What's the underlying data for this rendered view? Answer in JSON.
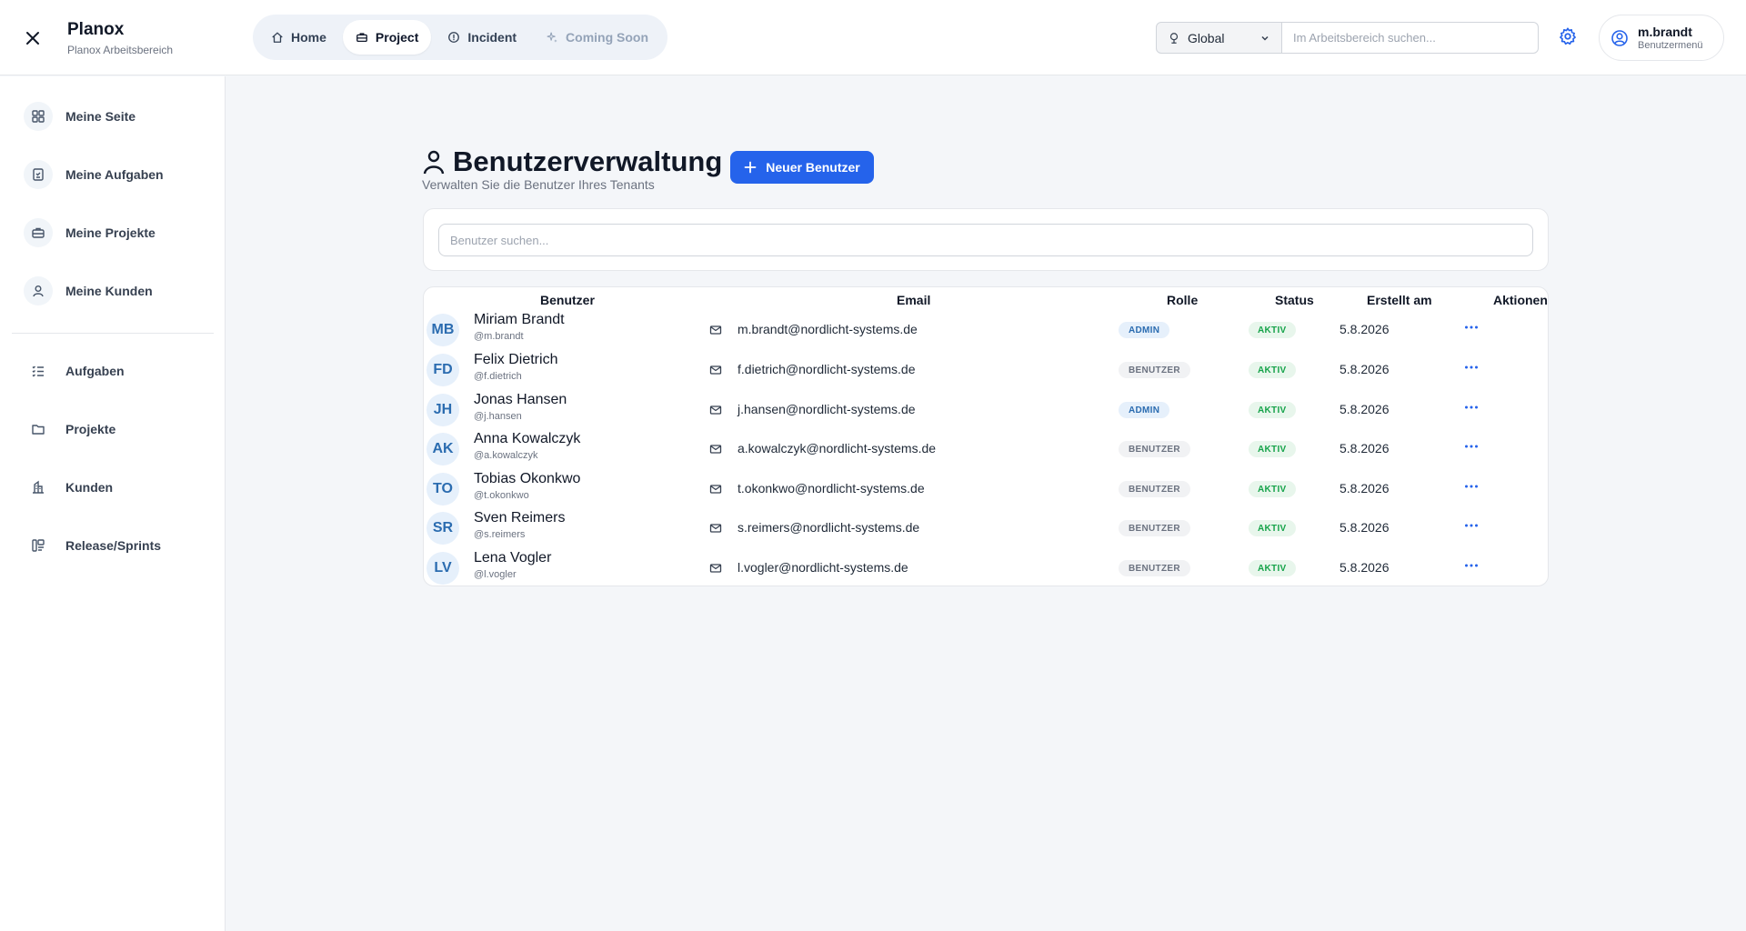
{
  "header": {
    "close_icon": "close-icon",
    "brand_title": "Planox",
    "brand_subtitle": "Planox Arbeitsbereich",
    "nav": [
      {
        "label": "Home",
        "icon": "home-icon"
      },
      {
        "label": "Project",
        "icon": "briefcase-icon",
        "active": true
      },
      {
        "label": "Incident",
        "icon": "alert-circle-icon"
      },
      {
        "label": "Coming Soon",
        "icon": "sparkles-icon",
        "disabled": true
      }
    ],
    "scope": "Global",
    "search_placeholder": "Im Arbeitsbereich suchen...",
    "user": {
      "name": "m.brandt",
      "menu_label": "Benutzermenü"
    }
  },
  "sidebar": {
    "personal": [
      {
        "label": "Meine Seite",
        "icon": "dashboard-icon"
      },
      {
        "label": "Meine Aufgaben",
        "icon": "task-icon"
      },
      {
        "label": "Meine Projekte",
        "icon": "briefcase-icon"
      },
      {
        "label": "Meine Kunden",
        "icon": "user-icon"
      }
    ],
    "general": [
      {
        "label": "Aufgaben",
        "icon": "list-check-icon"
      },
      {
        "label": "Projekte",
        "icon": "folder-icon"
      },
      {
        "label": "Kunden",
        "icon": "building-icon"
      },
      {
        "label": "Release/Sprints",
        "icon": "kanban-icon"
      }
    ]
  },
  "page": {
    "title": "Benutzerverwaltung",
    "subtitle": "Verwalten Sie die Benutzer Ihres Tenants",
    "new_button": "Neuer Benutzer",
    "search_placeholder": "Benutzer suchen..."
  },
  "table": {
    "columns": [
      "Benutzer",
      "Email",
      "Rolle",
      "Status",
      "Erstellt am",
      "Aktionen"
    ],
    "rows": [
      {
        "initials": "MB",
        "name": "Miriam Brandt",
        "handle": "@m.brandt",
        "email": "m.brandt@nordlicht-systems.de",
        "role": "ADMIN",
        "status": "AKTIV",
        "created": "5.8.2026"
      },
      {
        "initials": "FD",
        "name": "Felix Dietrich",
        "handle": "@f.dietrich",
        "email": "f.dietrich@nordlicht-systems.de",
        "role": "BENUTZER",
        "status": "AKTIV",
        "created": "5.8.2026"
      },
      {
        "initials": "JH",
        "name": "Jonas Hansen",
        "handle": "@j.hansen",
        "email": "j.hansen@nordlicht-systems.de",
        "role": "ADMIN",
        "status": "AKTIV",
        "created": "5.8.2026"
      },
      {
        "initials": "AK",
        "name": "Anna Kowalczyk",
        "handle": "@a.kowalczyk",
        "email": "a.kowalczyk@nordlicht-systems.de",
        "role": "BENUTZER",
        "status": "AKTIV",
        "created": "5.8.2026"
      },
      {
        "initials": "TO",
        "name": "Tobias Okonkwo",
        "handle": "@t.okonkwo",
        "email": "t.okonkwo@nordlicht-systems.de",
        "role": "BENUTZER",
        "status": "AKTIV",
        "created": "5.8.2026"
      },
      {
        "initials": "SR",
        "name": "Sven Reimers",
        "handle": "@s.reimers",
        "email": "s.reimers@nordlicht-systems.de",
        "role": "BENUTZER",
        "status": "AKTIV",
        "created": "5.8.2026"
      },
      {
        "initials": "LV",
        "name": "Lena Vogler",
        "handle": "@l.vogler",
        "email": "l.vogler@nordlicht-systems.de",
        "role": "BENUTZER",
        "status": "AKTIV",
        "created": "5.8.2026"
      }
    ]
  },
  "colors": {
    "accent": "#2563eb",
    "admin_badge": "#e6f0fb",
    "user_badge": "#f1f2f4",
    "status_active": "#16a34a"
  }
}
